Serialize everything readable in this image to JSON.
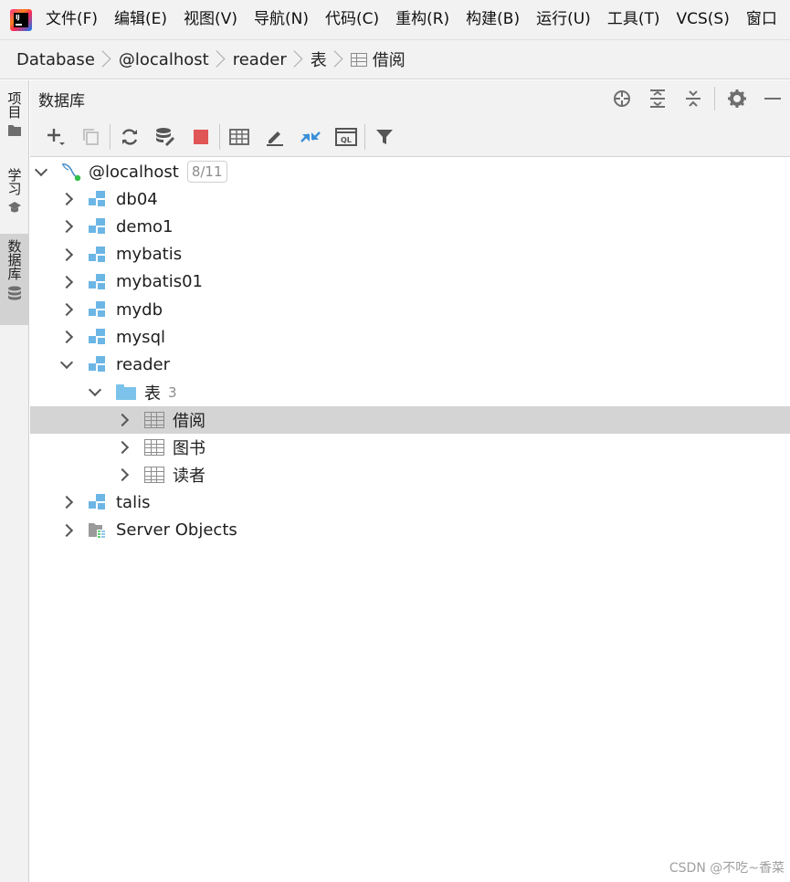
{
  "menu": {
    "items": [
      "文件(F)",
      "编辑(E)",
      "视图(V)",
      "导航(N)",
      "代码(C)",
      "重构(R)",
      "构建(B)",
      "运行(U)",
      "工具(T)",
      "VCS(S)",
      "窗口"
    ]
  },
  "breadcrumb": [
    "Database",
    "@localhost",
    "reader",
    "表",
    "借阅"
  ],
  "side_tabs": {
    "project": "项目",
    "learn": "学习",
    "database": "数据库"
  },
  "panel": {
    "title": "数据库"
  },
  "tree": {
    "host": {
      "label": "@localhost",
      "badge": "8/11"
    },
    "schemas_top": [
      "db04",
      "demo1",
      "mybatis",
      "mybatis01",
      "mydb",
      "mysql"
    ],
    "reader": {
      "label": "reader",
      "tables_folder": "表",
      "tables_count": "3",
      "tables": [
        "借阅",
        "图书",
        "读者"
      ],
      "selected_table": "借阅"
    },
    "schemas_bottom": [
      "talis"
    ],
    "server_objects": "Server Objects"
  },
  "watermark": "CSDN @不吃~香菜",
  "colors": {
    "schema_blue": "#6cb6e6",
    "stop_red": "#e05555",
    "selection": "#d4d4d4",
    "host_green": "#2fbf4a"
  }
}
